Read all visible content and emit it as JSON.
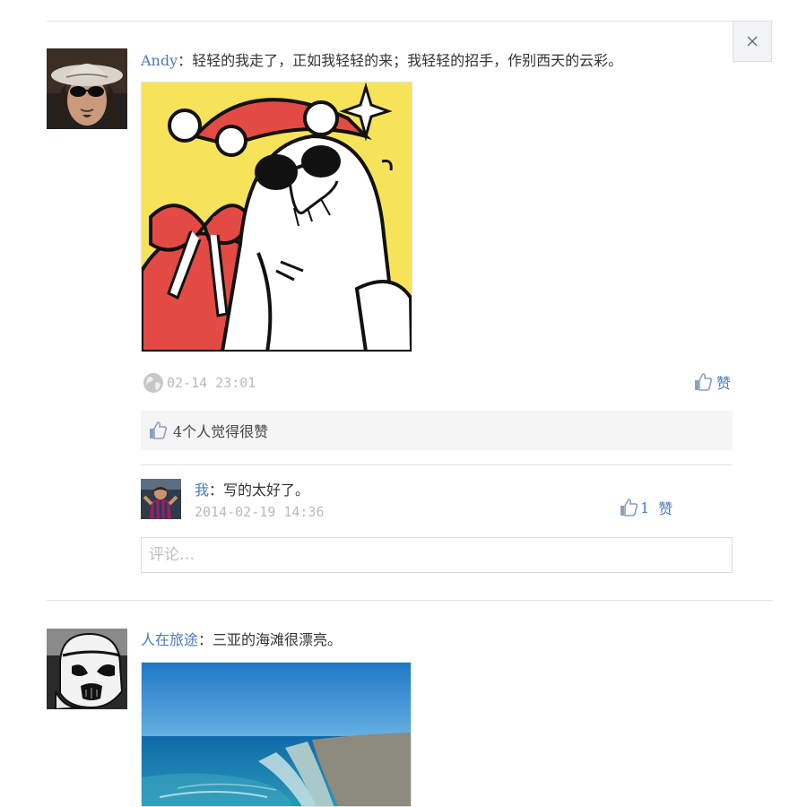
{
  "close_button": {
    "icon": "close-icon"
  },
  "posts": [
    {
      "author": "Andy",
      "separator": "：",
      "content": "轻轻的我走了，正如我轻轻的来；我轻轻的招手，作别西天的云彩。",
      "avatar": "avatar-man-with-hat-and-sunglasses",
      "image": "cartoon-polar-bear-santa-hat",
      "timestamp": "02-14 23:01",
      "like_label": "赞",
      "likes_summary": "4个人觉得很赞",
      "comments": [
        {
          "author": "我",
          "separator": "：",
          "text": "写的太好了。",
          "timestamp": "2014-02-19 14:36",
          "like_count": "1",
          "like_label": "赞",
          "avatar": "avatar-soccer-player"
        }
      ],
      "comment_input": {
        "placeholder": "评论…",
        "value": ""
      }
    },
    {
      "author": "人在旅途",
      "separator": "：",
      "content": "三亚的海滩很漂亮。",
      "avatar": "avatar-stormtrooper",
      "image": "beach-ocean-photo"
    }
  ],
  "colors": {
    "link": "#4a7ab7",
    "muted": "#b9b9b9",
    "divider": "#e2e2e2",
    "likes_bar_bg": "#f5f5f5"
  }
}
